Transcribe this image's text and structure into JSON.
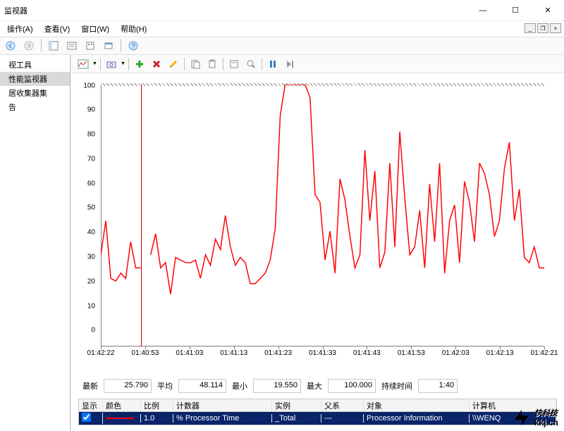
{
  "window": {
    "title": "监视器"
  },
  "menu": {
    "items": [
      "操作(A)",
      "查看(V)",
      "窗口(W)",
      "帮助(H)"
    ]
  },
  "sidebar": {
    "items": [
      {
        "label": "视工具"
      },
      {
        "label": "性能监视器",
        "selected": true
      },
      {
        "label": "居收集器集"
      },
      {
        "label": "告"
      }
    ]
  },
  "stats": {
    "latest_label": "最新",
    "latest": "25.790",
    "avg_label": "平均",
    "avg": "48.114",
    "min_label": "最小",
    "min": "19.550",
    "max_label": "最大",
    "max": "100.000",
    "duration_label": "持续时间",
    "duration": "1:40"
  },
  "legend": {
    "headers": [
      "显示",
      "颜色",
      "比例",
      "计数器",
      "实例",
      "父系",
      "对象",
      "计算机"
    ],
    "row": {
      "show_checked": true,
      "scale": "1.0",
      "counter": "% Processor Time",
      "instance": "_Total",
      "parent": "---",
      "object": "Processor Information",
      "computer": "\\\\WENQ"
    }
  },
  "chart_data": {
    "type": "line",
    "title": "",
    "ylabel": "",
    "xlabel": "",
    "ylim": [
      0,
      100
    ],
    "y_ticks": [
      0,
      10,
      20,
      30,
      40,
      50,
      60,
      70,
      80,
      90,
      100
    ],
    "x_labels": [
      "01:42:22",
      "01:40:53",
      "01:41:03",
      "01:41:13",
      "01:41:23",
      "01:41:33",
      "01:41:43",
      "01:41:53",
      "01:42:03",
      "01:42:13",
      "01:42:21"
    ],
    "cursor_at_index": 8,
    "series": [
      {
        "name": "% Processor Time",
        "color": "#ff0000",
        "values": [
          35,
          48,
          26,
          25,
          28,
          26,
          40,
          30,
          30,
          null,
          35,
          43,
          30,
          32,
          20,
          34,
          33,
          32,
          32,
          33,
          26,
          35,
          31,
          41,
          37,
          50,
          38,
          31,
          34,
          32,
          24,
          24,
          26,
          28,
          33,
          45,
          88,
          100,
          100,
          100,
          100,
          100,
          95,
          58,
          55,
          33,
          44,
          28,
          64,
          56,
          42,
          30,
          35,
          75,
          48,
          67,
          30,
          36,
          70,
          38,
          82,
          57,
          35,
          38,
          52,
          30,
          62,
          40,
          70,
          28,
          48,
          54,
          32,
          63,
          55,
          40,
          70,
          66,
          58,
          42,
          48,
          68,
          78,
          48,
          60,
          34,
          32,
          38,
          30,
          30
        ]
      }
    ]
  },
  "watermark": {
    "brand": "快科技",
    "url": "kkj.cn"
  }
}
